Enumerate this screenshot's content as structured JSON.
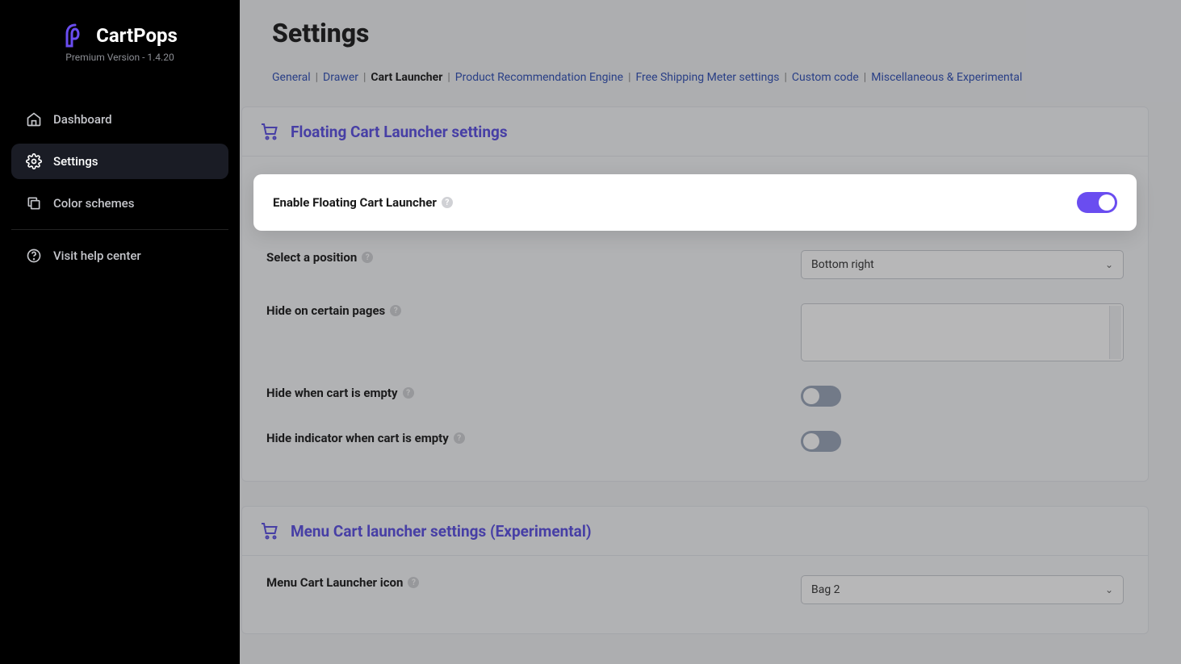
{
  "brand": {
    "name": "CartPops",
    "tagline": "Premium Version - 1.4.20"
  },
  "sidebar": {
    "items": [
      {
        "label": "Dashboard",
        "icon": "home"
      },
      {
        "label": "Settings",
        "icon": "gear"
      },
      {
        "label": "Color schemes",
        "icon": "copy"
      }
    ],
    "help": {
      "label": "Visit help center"
    }
  },
  "page": {
    "title": "Settings"
  },
  "tabs": [
    {
      "label": "General",
      "active": false
    },
    {
      "label": "Drawer",
      "active": false
    },
    {
      "label": "Cart Launcher",
      "active": true
    },
    {
      "label": "Product Recommendation Engine",
      "active": false
    },
    {
      "label": "Free Shipping Meter settings",
      "active": false
    },
    {
      "label": "Custom code",
      "active": false
    },
    {
      "label": "Miscellaneous & Experimental",
      "active": false
    }
  ],
  "panels": {
    "floating": {
      "title": "Floating Cart Launcher settings",
      "enable_label": "Enable Floating Cart Launcher",
      "enable_on": true,
      "position_label": "Select a position",
      "position_value": "Bottom right",
      "hide_pages_label": "Hide on certain pages",
      "hide_empty_label": "Hide when cart is empty",
      "hide_empty_on": false,
      "hide_indicator_label": "Hide indicator when cart is empty",
      "hide_indicator_on": false
    },
    "menu": {
      "title": "Menu Cart launcher settings (Experimental)",
      "icon_label": "Menu Cart Launcher icon",
      "icon_value": "Bag 2"
    }
  }
}
